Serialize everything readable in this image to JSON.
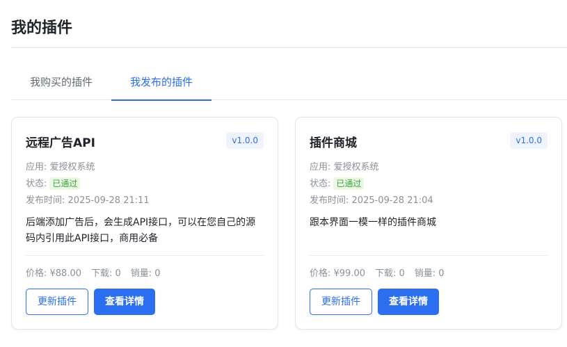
{
  "page": {
    "title": "我的插件"
  },
  "tabs": [
    {
      "label": "我购买的插件",
      "active": false
    },
    {
      "label": "我发布的插件",
      "active": true
    }
  ],
  "colors": {
    "accent": "#2b6ef0",
    "success": "#3ba53b",
    "muted": "#8a9099"
  },
  "cards": [
    {
      "title": "远程广告API",
      "version": "v1.0.0",
      "app_label": "应用:",
      "app": "爱授权系统",
      "status_label": "状态:",
      "status": "已通过",
      "time_label": "发布时间:",
      "time": "2025-09-28 21:11",
      "description": "后端添加广告后，会生成API接口，可以在您自己的源码内引用此API接口，商用必备",
      "price": "价格: ¥88.00",
      "downloads": "下载: 0",
      "sales": "销量: 0",
      "update_label": "更新插件",
      "detail_label": "查看详情"
    },
    {
      "title": "插件商城",
      "version": "v1.0.0",
      "app_label": "应用:",
      "app": "爱授权系统",
      "status_label": "状态:",
      "status": "已通过",
      "time_label": "发布时间:",
      "time": "2025-09-28 21:04",
      "description": "跟本界面一模一样的插件商城",
      "price": "价格: ¥99.00",
      "downloads": "下载: 0",
      "sales": "销量: 0",
      "update_label": "更新插件",
      "detail_label": "查看详情"
    }
  ]
}
